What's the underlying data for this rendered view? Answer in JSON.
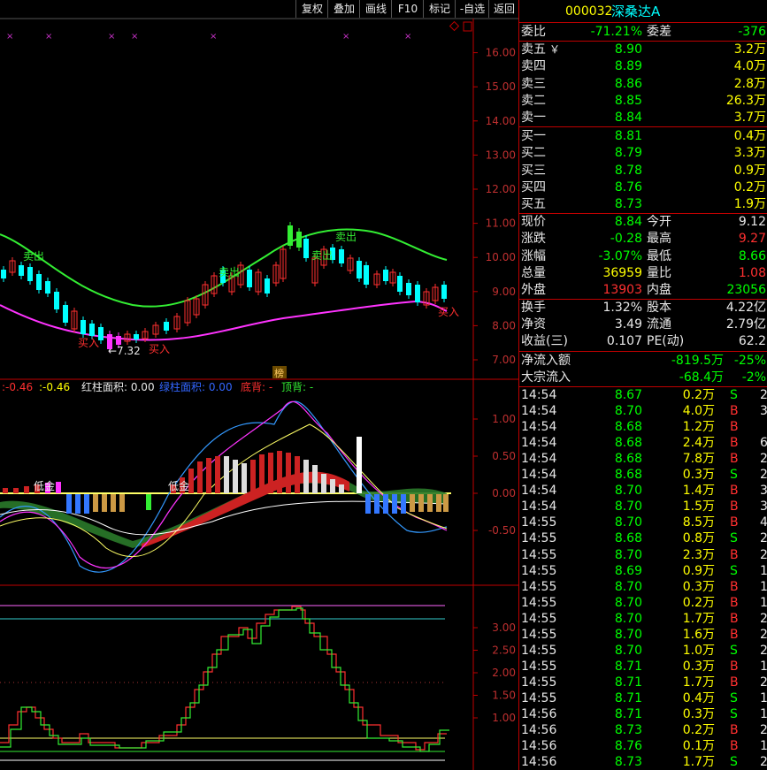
{
  "toolbar": {
    "buttons": [
      "复权",
      "叠加",
      "画线",
      "F10",
      "标记",
      "-自选",
      "返回"
    ]
  },
  "stock": {
    "code": "000032",
    "name": "深桑达A"
  },
  "main_chart": {
    "price_ticks": [
      "16.00",
      "15.00",
      "14.00",
      "13.00",
      "12.00",
      "11.00",
      "10.00",
      "9.00",
      "8.00",
      "7.00"
    ],
    "low_marker": "←7.32",
    "signals": [
      "卖出",
      "卖出",
      "卖出",
      "买入",
      "买入",
      "买入"
    ],
    "bang_label": "榜"
  },
  "indicator": {
    "header_values": [
      ":-0.46",
      ":-0.46"
    ],
    "red_area_label": "红柱面积: 0.00",
    "green_area_label": "绿柱面积: 0.00",
    "bottom_div_label": "底背: -",
    "top_div_label": "顶背: -",
    "ticks": [
      "1.00",
      "0.50",
      "0.00",
      "-0.50"
    ],
    "low_gold_label": "低金"
  },
  "step_chart": {
    "ticks": [
      "3.00",
      "2.50",
      "2.00",
      "1.50",
      "1.00"
    ]
  },
  "order_book": {
    "ratio_label": "委比",
    "ratio_value": "-71.21%",
    "diff_label": "委差",
    "diff_value": "-376",
    "asks": [
      {
        "label": "卖五",
        "mark": "￥",
        "price": "8.90",
        "vol": "3.2万"
      },
      {
        "label": "卖四",
        "mark": "",
        "price": "8.89",
        "vol": "4.0万"
      },
      {
        "label": "卖三",
        "mark": "",
        "price": "8.86",
        "vol": "2.8万"
      },
      {
        "label": "卖二",
        "mark": "",
        "price": "8.85",
        "vol": "26.3万"
      },
      {
        "label": "卖一",
        "mark": "",
        "price": "8.84",
        "vol": "3.7万"
      }
    ],
    "bids": [
      {
        "label": "买一",
        "price": "8.81",
        "vol": "0.4万"
      },
      {
        "label": "买二",
        "price": "8.79",
        "vol": "3.3万"
      },
      {
        "label": "买三",
        "price": "8.78",
        "vol": "0.9万"
      },
      {
        "label": "买四",
        "price": "8.76",
        "vol": "0.2万"
      },
      {
        "label": "买五",
        "price": "8.73",
        "vol": "1.9万"
      }
    ]
  },
  "quote": [
    {
      "l1": "现价",
      "v1": "8.84",
      "c1": "g",
      "l2": "今开",
      "v2": "9.12",
      "c2": "w"
    },
    {
      "l1": "涨跌",
      "v1": "-0.28",
      "c1": "g",
      "l2": "最高",
      "v2": "9.27",
      "c2": "r"
    },
    {
      "l1": "涨幅",
      "v1": "-3.07%",
      "c1": "g",
      "l2": "最低",
      "v2": "8.66",
      "c2": "g"
    },
    {
      "l1": "总量",
      "v1": "36959",
      "c1": "y",
      "l2": "量比",
      "v2": "1.08",
      "c2": "r"
    },
    {
      "l1": "外盘",
      "v1": "13903",
      "c1": "r",
      "l2": "内盘",
      "v2": "23056",
      "c2": "g"
    }
  ],
  "fundamentals": [
    {
      "l1": "换手",
      "v1": "1.32%",
      "l2": "股本",
      "v2": "4.22亿"
    },
    {
      "l1": "净资",
      "v1": "3.49",
      "l2": "流通",
      "v2": "2.79亿"
    },
    {
      "l1": "收益(三)",
      "v1": "0.107",
      "l2": "PE(动)",
      "v2": "62.2"
    }
  ],
  "flows": [
    {
      "label": "净流入额",
      "value": "-819.5万",
      "pct": "-25%"
    },
    {
      "label": "大宗流入",
      "value": "-68.4万",
      "pct": "-2%"
    }
  ],
  "trades": [
    {
      "t": "14:54",
      "p": "8.67",
      "v": "0.2万",
      "s": "S",
      "n": "2"
    },
    {
      "t": "14:54",
      "p": "8.70",
      "v": "4.0万",
      "s": "B",
      "n": "3"
    },
    {
      "t": "14:54",
      "p": "8.68",
      "v": "1.2万",
      "s": "B",
      "n": ""
    },
    {
      "t": "14:54",
      "p": "8.68",
      "v": "2.4万",
      "s": "B",
      "n": "6"
    },
    {
      "t": "14:54",
      "p": "8.68",
      "v": "7.8万",
      "s": "B",
      "n": "2"
    },
    {
      "t": "14:54",
      "p": "8.68",
      "v": "0.3万",
      "s": "S",
      "n": "2"
    },
    {
      "t": "14:54",
      "p": "8.70",
      "v": "1.4万",
      "s": "B",
      "n": "3"
    },
    {
      "t": "14:54",
      "p": "8.70",
      "v": "1.5万",
      "s": "B",
      "n": "3"
    },
    {
      "t": "14:55",
      "p": "8.70",
      "v": "8.5万",
      "s": "B",
      "n": "4"
    },
    {
      "t": "14:55",
      "p": "8.68",
      "v": "0.8万",
      "s": "S",
      "n": "2"
    },
    {
      "t": "14:55",
      "p": "8.70",
      "v": "2.3万",
      "s": "B",
      "n": "2"
    },
    {
      "t": "14:55",
      "p": "8.69",
      "v": "0.9万",
      "s": "S",
      "n": "1"
    },
    {
      "t": "14:55",
      "p": "8.70",
      "v": "0.3万",
      "s": "B",
      "n": "1"
    },
    {
      "t": "14:55",
      "p": "8.70",
      "v": "0.2万",
      "s": "B",
      "n": "1"
    },
    {
      "t": "14:55",
      "p": "8.70",
      "v": "1.7万",
      "s": "B",
      "n": "2"
    },
    {
      "t": "14:55",
      "p": "8.70",
      "v": "1.6万",
      "s": "B",
      "n": "2"
    },
    {
      "t": "14:55",
      "p": "8.70",
      "v": "1.0万",
      "s": "S",
      "n": "2"
    },
    {
      "t": "14:55",
      "p": "8.71",
      "v": "0.3万",
      "s": "B",
      "n": "1"
    },
    {
      "t": "14:55",
      "p": "8.71",
      "v": "1.7万",
      "s": "B",
      "n": "2"
    },
    {
      "t": "14:55",
      "p": "8.71",
      "v": "0.4万",
      "s": "S",
      "n": "1"
    },
    {
      "t": "14:56",
      "p": "8.71",
      "v": "0.3万",
      "s": "S",
      "n": "1"
    },
    {
      "t": "14:56",
      "p": "8.73",
      "v": "0.2万",
      "s": "B",
      "n": "2"
    },
    {
      "t": "14:56",
      "p": "8.76",
      "v": "0.1万",
      "s": "B",
      "n": "1"
    },
    {
      "t": "14:56",
      "p": "8.73",
      "v": "1.7万",
      "s": "S",
      "n": "2"
    }
  ],
  "colors": {
    "up": "#ff3030",
    "down": "#00ffff",
    "green_text": "#00ff00",
    "yellow": "#ffff00",
    "divider": "#c00000",
    "ma_green": "#33ee33",
    "ma_magenta": "#ff33ff"
  }
}
